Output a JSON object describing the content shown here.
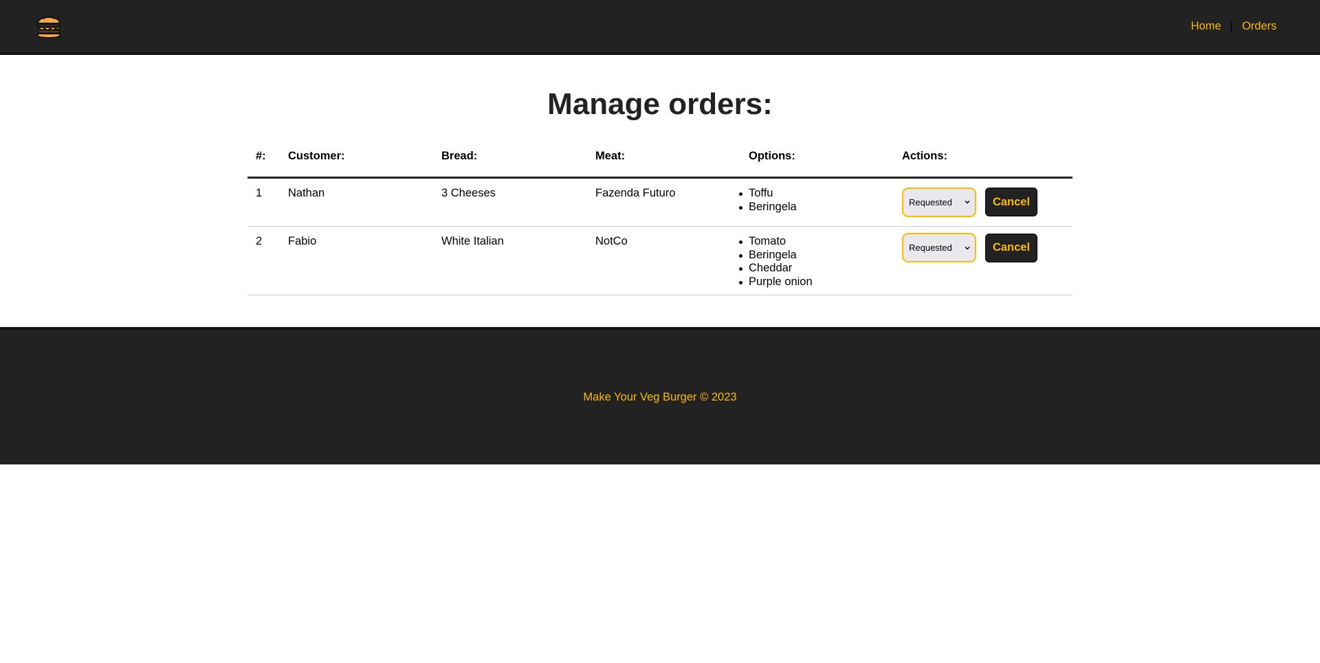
{
  "header": {
    "logo_icon": "burger-icon",
    "nav": {
      "home": "Home",
      "separator": "|",
      "orders": "Orders"
    }
  },
  "main": {
    "title": "Manage orders:",
    "table": {
      "headers": {
        "number": "#:",
        "customer": "Customer:",
        "bread": "Bread:",
        "meat": "Meat:",
        "options": "Options:",
        "actions": "Actions:"
      },
      "rows": [
        {
          "number": "1",
          "customer": "Nathan",
          "bread": "3 Cheeses",
          "meat": "Fazenda Futuro",
          "options": [
            "Toffu",
            "Beringela"
          ],
          "status": "Requested",
          "cancel_label": "Cancel"
        },
        {
          "number": "2",
          "customer": "Fabio",
          "bread": "White Italian",
          "meat": "NotCo",
          "options": [
            "Tomato",
            "Beringela",
            "Cheddar",
            "Purple onion"
          ],
          "status": "Requested",
          "cancel_label": "Cancel"
        }
      ]
    }
  },
  "footer": {
    "text": "Make Your Veg Burger © 2023"
  },
  "colors": {
    "dark": "#222222",
    "accent": "#fcba03",
    "select_bg": "#e9e9ed"
  }
}
